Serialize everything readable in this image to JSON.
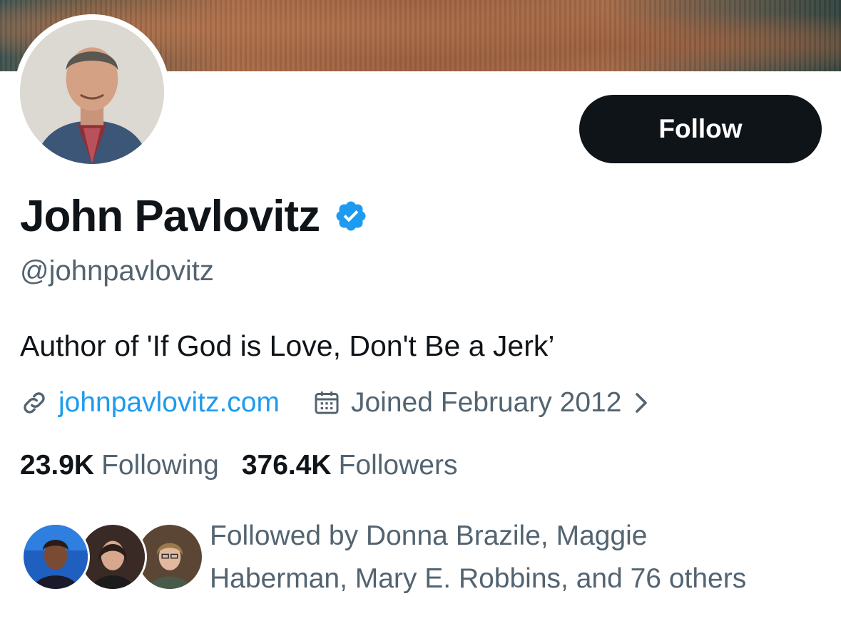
{
  "profile": {
    "name": "John Pavlovitz",
    "handle": "@johnpavlovitz",
    "bio": "Author of 'If God is Love, Don't Be a Jerk’",
    "website": "johnpavlovitz.com",
    "joined": "Joined February 2012",
    "verified": true
  },
  "actions": {
    "follow_label": "Follow"
  },
  "stats": {
    "following_count": "23.9K",
    "following_label": "Following",
    "followers_count": "376.4K",
    "followers_label": "Followers"
  },
  "followed_by": {
    "line1": "Followed by Donna Brazile, Maggie",
    "line2": "Haberman, Mary E. Robbins, and 76 others"
  },
  "icons": {
    "verified": "verified-badge-icon",
    "link": "link-icon",
    "calendar": "calendar-icon",
    "chevron": "chevron-right-icon"
  },
  "colors": {
    "accent": "#1d9bf0",
    "verified": "#1d9bf0",
    "text_primary": "#0f1419",
    "text_secondary": "#536471",
    "button_bg": "#0f1419"
  }
}
